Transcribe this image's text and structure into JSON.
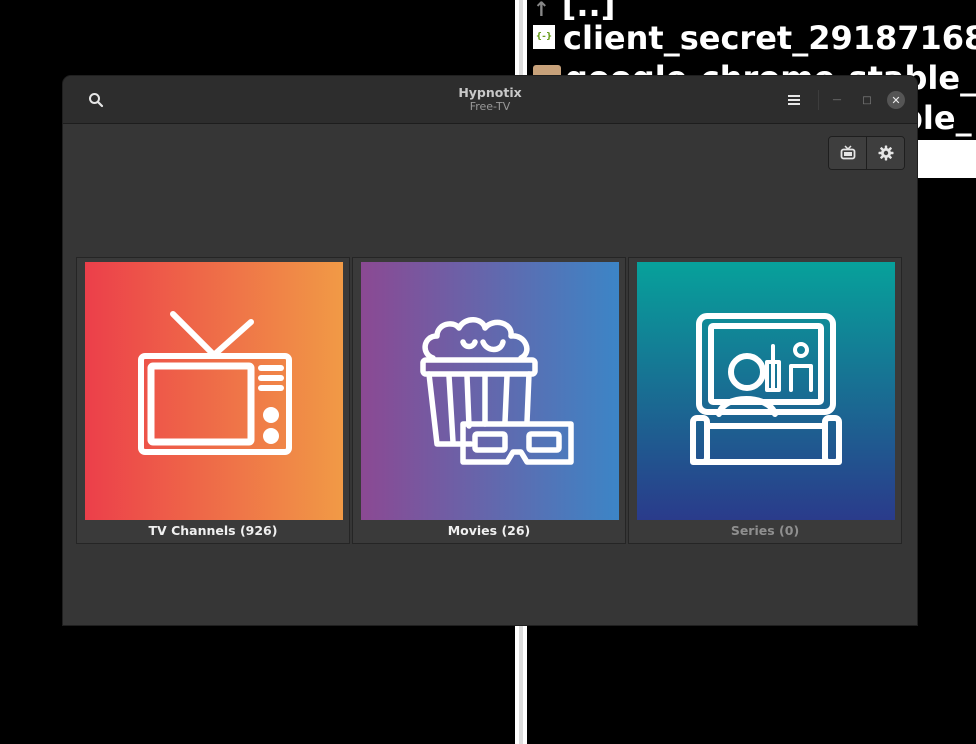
{
  "background": {
    "rows": [
      {
        "icon": "",
        "text": "[..]"
      },
      {
        "icon": "{-}",
        "text": "client_secret_29187168"
      },
      {
        "icon": "",
        "text": "google-chrome-stable_"
      },
      {
        "icon": "",
        "text": "ble_"
      }
    ]
  },
  "window": {
    "title": "Hypnotix",
    "subtitle": "Free-TV"
  },
  "headerbar": {
    "search_icon": "search-icon",
    "menu_icon": "hamburger-menu-icon",
    "minimize_glyph": "—",
    "maximize_glyph": "□",
    "close_glyph": "✕"
  },
  "toolbar": {
    "buttons": [
      {
        "icon": "tv-icon"
      },
      {
        "icon": "gear-icon"
      }
    ]
  },
  "categories": [
    {
      "label": "TV Channels (926)",
      "icon": "retro-tv-icon",
      "enabled": true,
      "colors": [
        "#ec3f4a",
        "#f19a46"
      ]
    },
    {
      "label": "Movies (26)",
      "icon": "popcorn-3d-glasses-icon",
      "enabled": true,
      "colors": [
        "#8b4993",
        "#3c85c6"
      ]
    },
    {
      "label": "Series (0)",
      "icon": "person-watching-tv-icon",
      "enabled": false,
      "colors": [
        "#07a19b",
        "#2a3b8b"
      ]
    }
  ]
}
